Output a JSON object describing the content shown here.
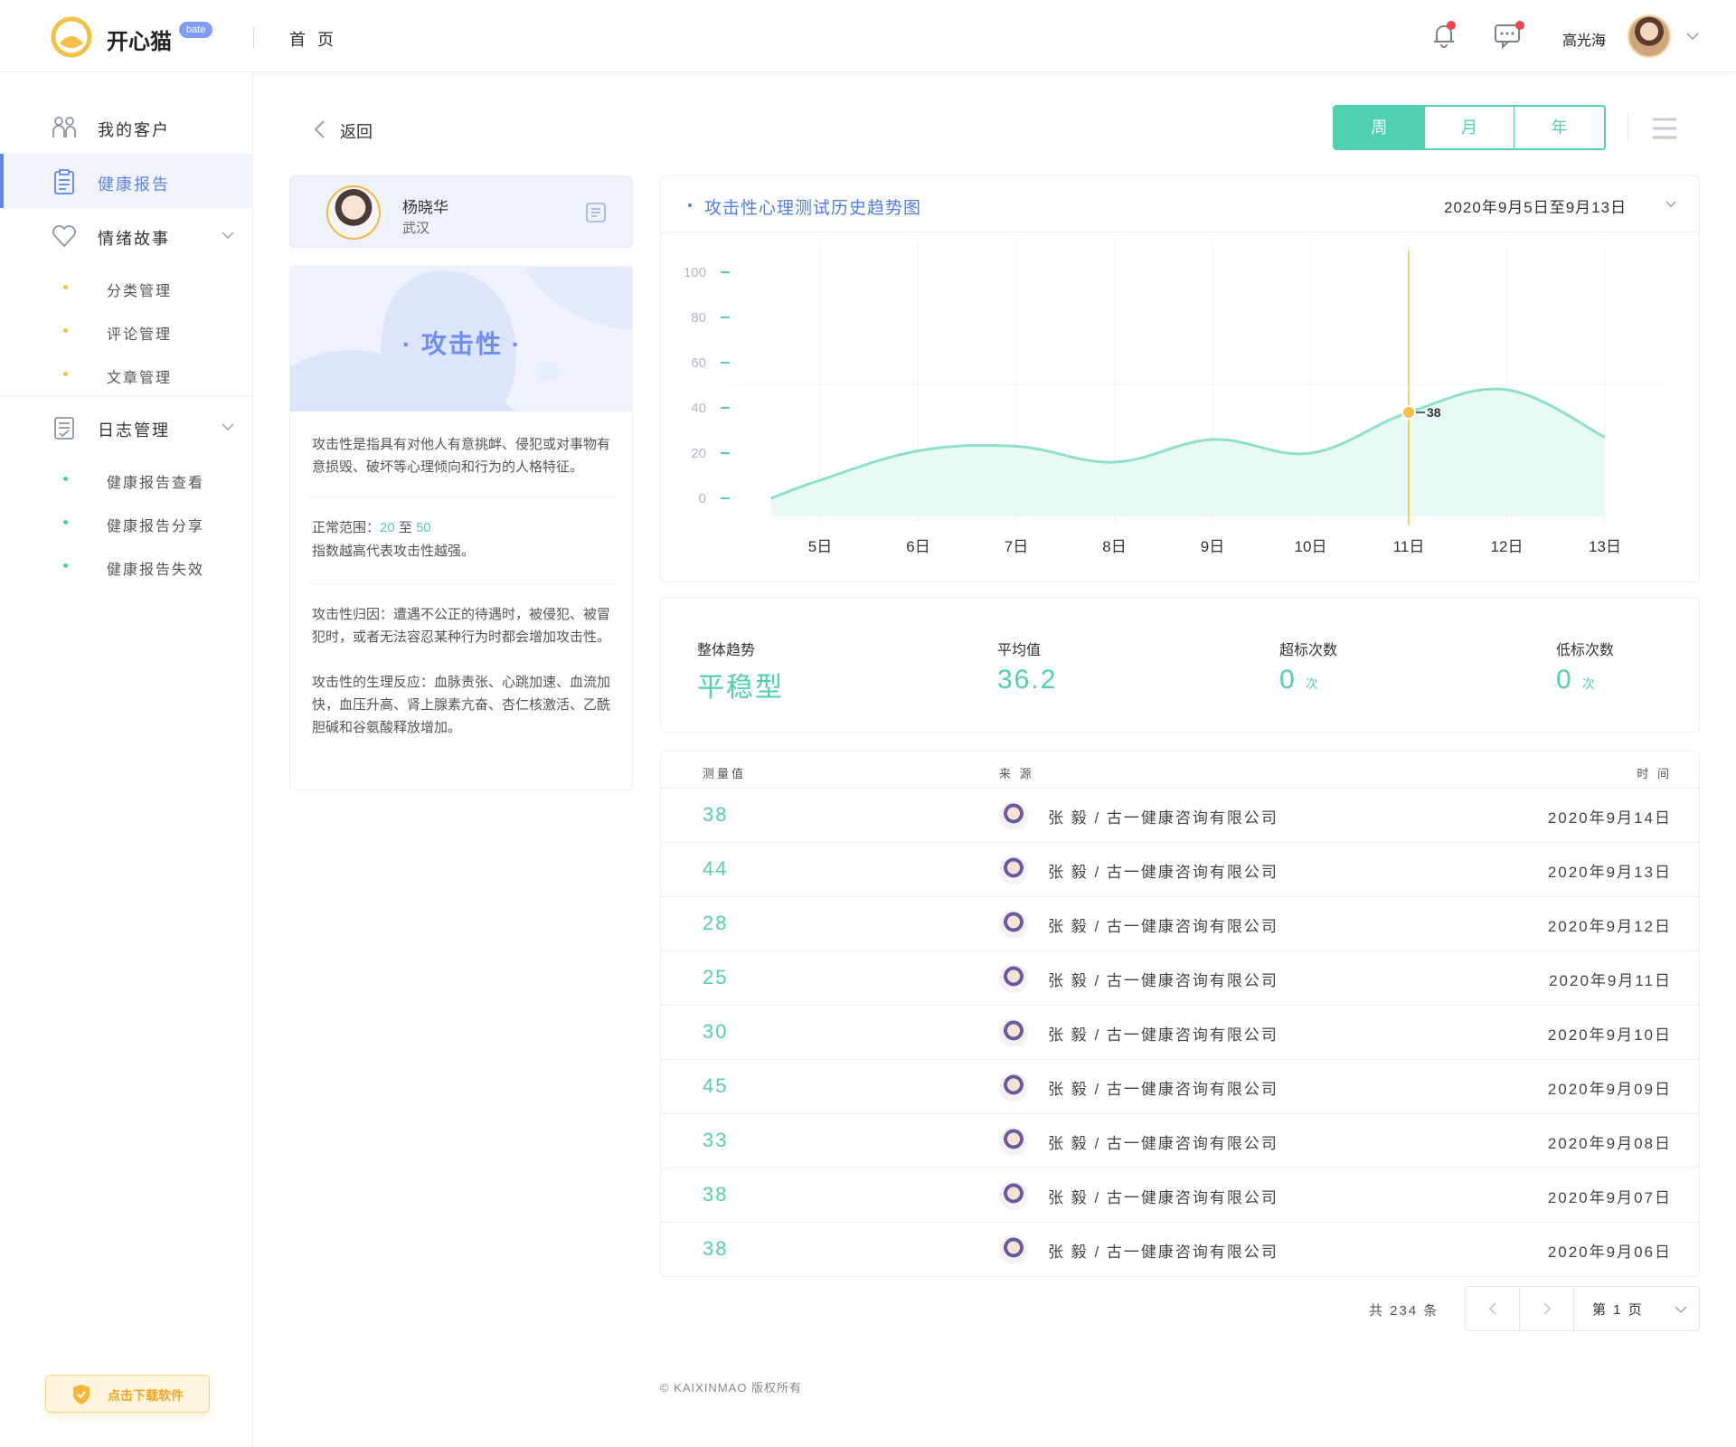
{
  "header": {
    "logo_text": "开心猫",
    "logo_badge": "bate",
    "home": "首 页",
    "user_name": "高光海",
    "colors": {
      "accent": "#4fd1b0",
      "brand_blue": "#5d86ea",
      "notify_dot": "#f2464b"
    },
    "icons": [
      "bell-icon",
      "message-icon",
      "chevron-down-icon"
    ]
  },
  "sidebar": {
    "items": [
      {
        "label": "我的客户",
        "icon": "customers-icon"
      },
      {
        "label": "健康报告",
        "icon": "clipboard-icon",
        "active": true
      },
      {
        "label": "情绪故事",
        "icon": "heart-icon"
      },
      {
        "label": "日志管理",
        "icon": "log-icon"
      }
    ],
    "emotion_sub": [
      "分类管理",
      "评论管理",
      "文章管理"
    ],
    "log_sub": [
      "健康报告查看",
      "健康报告分享",
      "健康报告失效"
    ],
    "download_label": "点击下载软件"
  },
  "nav": {
    "back_label": "返回",
    "tabs": [
      "周",
      "月",
      "年"
    ],
    "active_tab": "周"
  },
  "profile": {
    "name": "杨晓华",
    "city": "武汉"
  },
  "attribute": {
    "title": "· 攻击性 ·",
    "definition": "攻击性是指具有对他人有意挑衅、侵犯或对事物有意损毁、破坏等心理倾向和行为的人格特征。",
    "range_label": "正常范围：",
    "range_min": "20",
    "range_sep": "至",
    "range_max": "50",
    "range_note": "指数越高代表攻击性越强。",
    "cause": "攻击性归因：遭遇不公正的待遇时，被侵犯、被冒犯时，或者无法容忍某种行为时都会增加攻击性。",
    "reaction": "攻击性的生理反应：血脉责张、心跳加速、血流加快，血压升高、肾上腺素亢奋、杏仁核激活、乙酰胆碱和谷氨酸释放增加。"
  },
  "chart_header": {
    "title": "攻击性心理测试历史趋势图",
    "date_range": "2020年9月5日至9月13日"
  },
  "chart_data": {
    "type": "area",
    "title": "攻击性心理测试历史趋势图",
    "x_data": [
      4.5,
      5,
      6,
      7,
      8,
      9,
      10,
      11,
      12,
      13
    ],
    "y_data": [
      0,
      8,
      21,
      23,
      16,
      26,
      20,
      38,
      48,
      27
    ],
    "categories": [
      "5日",
      "6日",
      "7日",
      "8日",
      "9日",
      "10日",
      "11日",
      "12日",
      "13日"
    ],
    "category_x": [
      5,
      6,
      7,
      8,
      9,
      10,
      11,
      12,
      13
    ],
    "y_ticks": [
      0,
      20,
      40,
      60,
      80,
      100
    ],
    "ylim": [
      0,
      100
    ],
    "highlight": {
      "x": 11,
      "value": 38,
      "label": "38"
    },
    "grid": true,
    "colors": {
      "line": "#8fe0c8",
      "fill": "#e8faf4",
      "highlight": "#f5c045"
    }
  },
  "stats": [
    {
      "label": "整体趋势",
      "value": "平稳型",
      "unit": ""
    },
    {
      "label": "平均值",
      "value": "36.2",
      "unit": ""
    },
    {
      "label": "超标次数",
      "value": "0",
      "unit": "次"
    },
    {
      "label": "低标次数",
      "value": "0",
      "unit": "次"
    }
  ],
  "table": {
    "headers": {
      "value": "测量值",
      "source": "来 源",
      "time": "时 间"
    },
    "rows": [
      {
        "value": "38",
        "source": "张 毅 / 古一健康咨询有限公司",
        "time": "2020年9月14日"
      },
      {
        "value": "44",
        "source": "张 毅 / 古一健康咨询有限公司",
        "time": "2020年9月13日"
      },
      {
        "value": "28",
        "source": "张 毅 / 古一健康咨询有限公司",
        "time": "2020年9月12日"
      },
      {
        "value": "25",
        "source": "张 毅 / 古一健康咨询有限公司",
        "time": "2020年9月11日"
      },
      {
        "value": "30",
        "source": "张 毅 / 古一健康咨询有限公司",
        "time": "2020年9月10日"
      },
      {
        "value": "45",
        "source": "张 毅 / 古一健康咨询有限公司",
        "time": "2020年9月09日"
      },
      {
        "value": "33",
        "source": "张 毅 / 古一健康咨询有限公司",
        "time": "2020年9月08日"
      },
      {
        "value": "38",
        "source": "张 毅 / 古一健康咨询有限公司",
        "time": "2020年9月07日"
      },
      {
        "value": "38",
        "source": "张 毅 / 古一健康咨询有限公司",
        "time": "2020年9月06日"
      }
    ]
  },
  "pagination": {
    "total": "共 234 条",
    "page": "第  1  页"
  },
  "footer": {
    "copyright": "© KAIXINMAO 版权所有"
  }
}
